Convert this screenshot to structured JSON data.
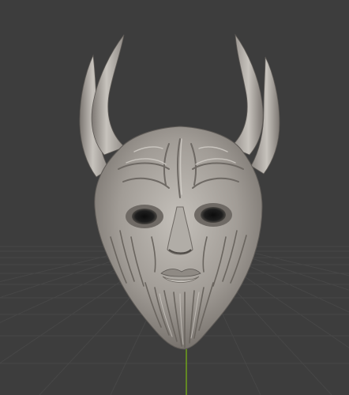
{
  "viewport": {
    "background_color": "#3d3d3d",
    "grid_color": "#474747",
    "grid_color_minor": "#434343",
    "y_axis_color": "#6fa21b"
  },
  "model": {
    "name": "horned-mask-sculpt",
    "base_color": "#9a958f",
    "highlight_color": "#c9c5bf",
    "shadow_color": "#5e5a56",
    "cavity_color": "#141414"
  }
}
